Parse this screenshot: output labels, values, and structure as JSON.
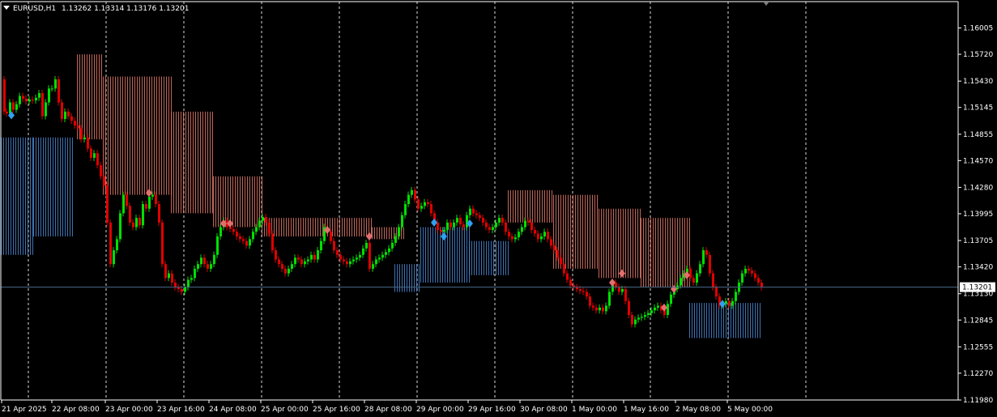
{
  "header": {
    "symbol": "EURUSD,H1",
    "ohlc": "1.13262 1.13314 1.13176 1.13201"
  },
  "price_line": {
    "label": "1.13201",
    "value": 1.13201,
    "color": "#4a6a8a"
  },
  "colors": {
    "background": "#000000",
    "up_candle": "#00e000",
    "down_candle": "#e00000",
    "cloud_bear": "#f08070",
    "cloud_bull": "#4f8fe0",
    "diamond_red": "#e07070",
    "diamond_blue": "#30a0f0",
    "grid": "#ffffff",
    "axis": "#ffffff",
    "marker": "#808080"
  },
  "chart_data": {
    "type": "candlestick",
    "symbol": "EURUSD",
    "timeframe": "H1",
    "ylim": [
      1.1198,
      1.1629
    ],
    "y_ticks": [
      "1.16005",
      "1.15720",
      "1.15430",
      "1.15145",
      "1.14855",
      "1.14570",
      "1.14280",
      "1.13995",
      "1.13705",
      "1.13420",
      "1.13130",
      "1.12845",
      "1.12555",
      "1.12270",
      "1.11980"
    ],
    "x_ticks": [
      "21 Apr 2025",
      "22 Apr 08:00",
      "23 Apr 00:00",
      "23 Apr 16:00",
      "24 Apr 08:00",
      "25 Apr 00:00",
      "25 Apr 16:00",
      "28 Apr 08:00",
      "29 Apr 00:00",
      "29 Apr 16:00",
      "30 Apr 08:00",
      "1 May 00:00",
      "1 May 16:00",
      "2 May 08:00",
      "5 May 00:00"
    ],
    "grid": "vertical dashed",
    "path": [
      [
        0,
        1.1545
      ],
      [
        3,
        1.151
      ],
      [
        6,
        1.1508
      ],
      [
        10,
        1.152
      ],
      [
        14,
        1.1512
      ],
      [
        18,
        1.1518
      ],
      [
        22,
        1.1527
      ],
      [
        26,
        1.1524
      ],
      [
        30,
        1.1521
      ],
      [
        34,
        1.1523
      ],
      [
        38,
        1.1522
      ],
      [
        42,
        1.1525
      ],
      [
        46,
        1.153
      ],
      [
        50,
        1.1505
      ],
      [
        54,
        1.152
      ],
      [
        58,
        1.1535
      ],
      [
        62,
        1.1535
      ],
      [
        66,
        1.1545
      ],
      [
        70,
        1.152
      ],
      [
        74,
        1.1502
      ],
      [
        78,
        1.151
      ],
      [
        82,
        1.1505
      ],
      [
        86,
        1.15
      ],
      [
        90,
        1.1495
      ],
      [
        94,
        1.1492
      ],
      [
        98,
        1.148
      ],
      [
        102,
        1.1482
      ],
      [
        106,
        1.147
      ],
      [
        110,
        1.146
      ],
      [
        114,
        1.1465
      ],
      [
        118,
        1.1452
      ],
      [
        122,
        1.144
      ],
      [
        126,
        1.143
      ],
      [
        130,
        1.139
      ],
      [
        134,
        1.1345
      ],
      [
        138,
        1.136
      ],
      [
        142,
        1.1372
      ],
      [
        146,
        1.14
      ],
      [
        150,
        1.142
      ],
      [
        154,
        1.1408
      ],
      [
        158,
        1.139
      ],
      [
        162,
        1.1385
      ],
      [
        166,
        1.1395
      ],
      [
        170,
        1.1387
      ],
      [
        174,
        1.141
      ],
      [
        178,
        1.1405
      ],
      [
        182,
        1.1418
      ],
      [
        186,
        1.142
      ],
      [
        190,
        1.141
      ],
      [
        194,
        1.139
      ],
      [
        198,
        1.1345
      ],
      [
        202,
        1.133
      ],
      [
        206,
        1.1335
      ],
      [
        210,
        1.1325
      ],
      [
        214,
        1.132
      ],
      [
        218,
        1.1318
      ],
      [
        222,
        1.1315
      ],
      [
        226,
        1.132
      ],
      [
        230,
        1.1328
      ],
      [
        234,
        1.133
      ],
      [
        238,
        1.134
      ],
      [
        242,
        1.1345
      ],
      [
        246,
        1.1352
      ],
      [
        250,
        1.1345
      ],
      [
        254,
        1.134
      ],
      [
        258,
        1.1345
      ],
      [
        262,
        1.1355
      ],
      [
        266,
        1.1375
      ],
      [
        270,
        1.1385
      ],
      [
        274,
        1.1392
      ],
      [
        278,
        1.1385
      ],
      [
        282,
        1.1383
      ],
      [
        286,
        1.138
      ],
      [
        290,
        1.1375
      ],
      [
        294,
        1.1372
      ],
      [
        298,
        1.137
      ],
      [
        302,
        1.1365
      ],
      [
        306,
        1.1372
      ],
      [
        310,
        1.138
      ],
      [
        314,
        1.1385
      ],
      [
        318,
        1.1392
      ],
      [
        322,
        1.1396
      ],
      [
        326,
        1.139
      ],
      [
        330,
        1.1378
      ],
      [
        334,
        1.136
      ],
      [
        338,
        1.135
      ],
      [
        342,
        1.1345
      ],
      [
        346,
        1.134
      ],
      [
        350,
        1.1335
      ],
      [
        354,
        1.134
      ],
      [
        358,
        1.1345
      ],
      [
        362,
        1.1352
      ],
      [
        366,
        1.135
      ],
      [
        370,
        1.1345
      ],
      [
        374,
        1.1348
      ],
      [
        378,
        1.135
      ],
      [
        382,
        1.1355
      ],
      [
        386,
        1.135
      ],
      [
        390,
        1.136
      ],
      [
        394,
        1.137
      ],
      [
        398,
        1.1385
      ],
      [
        402,
        1.138
      ],
      [
        406,
        1.137
      ],
      [
        410,
        1.136
      ],
      [
        414,
        1.1355
      ],
      [
        418,
        1.135
      ],
      [
        422,
        1.1348
      ],
      [
        426,
        1.1345
      ],
      [
        430,
        1.1348
      ],
      [
        434,
        1.135
      ],
      [
        438,
        1.1352
      ],
      [
        442,
        1.1355
      ],
      [
        446,
        1.1362
      ],
      [
        450,
        1.1368
      ],
      [
        454,
        1.134
      ],
      [
        458,
        1.1345
      ],
      [
        462,
        1.135
      ],
      [
        466,
        1.1352
      ],
      [
        470,
        1.1355
      ],
      [
        474,
        1.1358
      ],
      [
        478,
        1.1362
      ],
      [
        482,
        1.1368
      ],
      [
        486,
        1.1375
      ],
      [
        490,
        1.1385
      ],
      [
        494,
        1.1398
      ],
      [
        498,
        1.141
      ],
      [
        502,
        1.142
      ],
      [
        506,
        1.1425
      ],
      [
        510,
        1.1415
      ],
      [
        514,
        1.1405
      ],
      [
        518,
        1.1408
      ],
      [
        522,
        1.1412
      ],
      [
        526,
        1.141
      ],
      [
        530,
        1.14
      ],
      [
        534,
        1.139
      ],
      [
        538,
        1.1382
      ],
      [
        542,
        1.138
      ],
      [
        546,
        1.1382
      ],
      [
        550,
        1.139
      ],
      [
        554,
        1.1385
      ],
      [
        558,
        1.139
      ],
      [
        562,
        1.1395
      ],
      [
        566,
        1.1388
      ],
      [
        570,
        1.1385
      ],
      [
        574,
        1.1398
      ],
      [
        578,
        1.1405
      ],
      [
        582,
        1.14
      ],
      [
        586,
        1.1398
      ],
      [
        590,
        1.1395
      ],
      [
        594,
        1.139
      ],
      [
        598,
        1.1385
      ],
      [
        602,
        1.1382
      ],
      [
        606,
        1.1385
      ],
      [
        610,
        1.139
      ],
      [
        614,
        1.1395
      ],
      [
        618,
        1.139
      ],
      [
        622,
        1.138
      ],
      [
        626,
        1.1375
      ],
      [
        630,
        1.1372
      ],
      [
        634,
        1.1374
      ],
      [
        638,
        1.138
      ],
      [
        642,
        1.1385
      ],
      [
        646,
        1.1392
      ],
      [
        650,
        1.139
      ],
      [
        654,
        1.1382
      ],
      [
        658,
        1.1378
      ],
      [
        662,
        1.1372
      ],
      [
        666,
        1.1375
      ],
      [
        670,
        1.138
      ],
      [
        674,
        1.1372
      ],
      [
        678,
        1.1365
      ],
      [
        682,
        1.136
      ],
      [
        686,
        1.1352
      ],
      [
        690,
        1.1345
      ],
      [
        694,
        1.1335
      ],
      [
        698,
        1.1328
      ],
      [
        702,
        1.1322
      ],
      [
        706,
        1.132
      ],
      [
        710,
        1.1318
      ],
      [
        714,
        1.1316
      ],
      [
        718,
        1.1315
      ],
      [
        722,
        1.131
      ],
      [
        726,
        1.13
      ],
      [
        730,
        1.1298
      ],
      [
        734,
        1.1295
      ],
      [
        738,
        1.1298
      ],
      [
        742,
        1.1294
      ],
      [
        746,
        1.13
      ],
      [
        750,
        1.1315
      ],
      [
        754,
        1.1325
      ],
      [
        758,
        1.132
      ],
      [
        762,
        1.1315
      ],
      [
        766,
        1.1318
      ],
      [
        770,
        1.1305
      ],
      [
        774,
        1.129
      ],
      [
        778,
        1.128
      ],
      [
        782,
        1.1285
      ],
      [
        786,
        1.1287
      ],
      [
        790,
        1.1288
      ],
      [
        794,
        1.129
      ],
      [
        798,
        1.1292
      ],
      [
        802,
        1.1295
      ],
      [
        806,
        1.1298
      ],
      [
        810,
        1.13
      ],
      [
        814,
        1.1295
      ],
      [
        818,
        1.129
      ],
      [
        822,
        1.1302
      ],
      [
        826,
        1.1312
      ],
      [
        830,
        1.1318
      ],
      [
        834,
        1.1322
      ],
      [
        838,
        1.133
      ],
      [
        842,
        1.1335
      ],
      [
        846,
        1.134
      ],
      [
        850,
        1.133
      ],
      [
        854,
        1.1325
      ],
      [
        858,
        1.1335
      ],
      [
        862,
        1.1345
      ],
      [
        866,
        1.136
      ],
      [
        870,
        1.1355
      ],
      [
        874,
        1.1335
      ],
      [
        878,
        1.132
      ],
      [
        882,
        1.131
      ],
      [
        886,
        1.13
      ],
      [
        890,
        1.1302
      ],
      [
        894,
        1.1305
      ],
      [
        898,
        1.13
      ],
      [
        902,
        1.1305
      ],
      [
        906,
        1.1315
      ],
      [
        910,
        1.1325
      ],
      [
        914,
        1.1335
      ],
      [
        918,
        1.134
      ],
      [
        922,
        1.1338
      ],
      [
        926,
        1.1335
      ],
      [
        930,
        1.133
      ],
      [
        934,
        1.1325
      ],
      [
        938,
        1.132
      ]
    ],
    "diamonds_red": [
      [
        182,
        1.1422
      ],
      [
        274,
        1.1389
      ],
      [
        282,
        1.1389
      ],
      [
        402,
        1.1382
      ],
      [
        454,
        1.1375
      ],
      [
        754,
        1.1325
      ],
      [
        766,
        1.1335
      ],
      [
        818,
        1.1298
      ],
      [
        830,
        1.1318
      ],
      [
        846,
        1.1333
      ]
    ],
    "diamonds_blue": [
      [
        12,
        1.1506
      ],
      [
        534,
        1.139
      ],
      [
        546,
        1.1375
      ],
      [
        578,
        1.1389
      ],
      [
        890,
        1.1302
      ]
    ],
    "cloud_bear_segments": [
      [
        94,
        126,
        1.1572,
        1.148
      ],
      [
        126,
        210,
        1.1548,
        1.142
      ],
      [
        210,
        262,
        1.151,
        1.14
      ],
      [
        262,
        322,
        1.144,
        1.1385
      ],
      [
        322,
        458,
        1.1395,
        1.1375
      ],
      [
        458,
        498,
        1.1385,
        1.1372
      ],
      [
        626,
        682,
        1.1425,
        1.139
      ],
      [
        682,
        738,
        1.142,
        1.134
      ],
      [
        738,
        790,
        1.1405,
        1.133
      ],
      [
        790,
        850,
        1.1395,
        1.132
      ]
    ],
    "cloud_bull_segments": [
      [
        0,
        40,
        1.1482,
        1.1355
      ],
      [
        40,
        90,
        1.1482,
        1.1375
      ],
      [
        486,
        518,
        1.1345,
        1.1315
      ],
      [
        518,
        578,
        1.1385,
        1.1325
      ],
      [
        578,
        626,
        1.137,
        1.1333
      ],
      [
        850,
        938,
        1.1303,
        1.1265
      ]
    ]
  }
}
